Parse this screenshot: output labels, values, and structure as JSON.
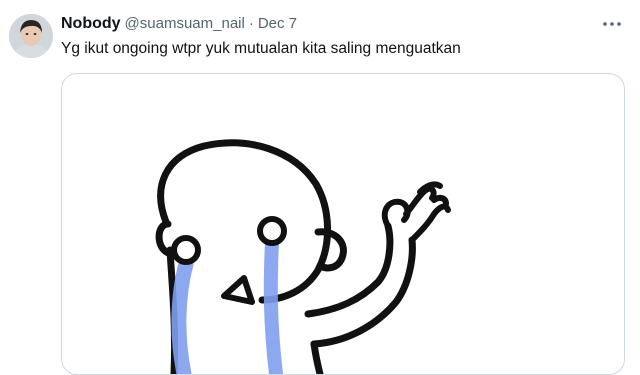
{
  "tweet": {
    "display_name": "Nobody",
    "handle": "@suamsuam_nail",
    "separator": "·",
    "date": "Dec 7",
    "text": "Yg ikut ongoing wtpr yuk mutualan kita saling menguatkan"
  },
  "icons": {
    "more": "more-dots-icon"
  },
  "colors": {
    "text_primary": "#0f1419",
    "text_secondary": "#536471",
    "border": "#cfd9de",
    "tears": "#7e9ff0"
  }
}
